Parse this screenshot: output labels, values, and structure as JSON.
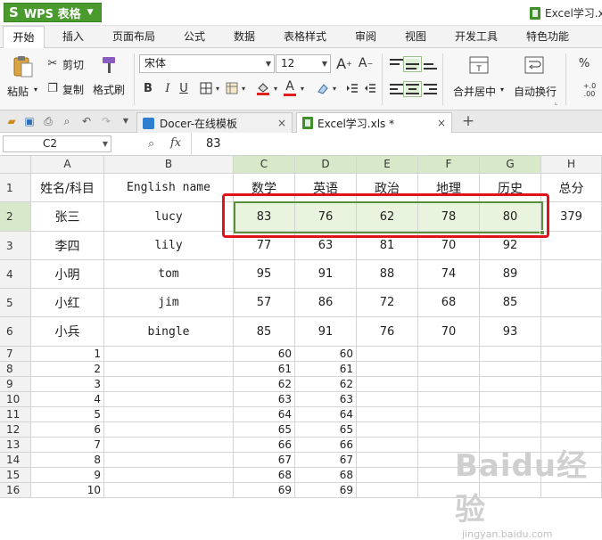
{
  "app": {
    "name": "WPS 表格",
    "logo_glyph": "S",
    "document_title": "Excel学习.x",
    "accent": "#4a9a2e"
  },
  "menu": [
    "开始",
    "插入",
    "页面布局",
    "公式",
    "数据",
    "表格样式",
    "审阅",
    "视图",
    "开发工具",
    "特色功能"
  ],
  "ribbon": {
    "paste": "粘贴",
    "cut": "剪切",
    "copy": "复制",
    "format_painter": "格式刷",
    "font_name": "宋体",
    "font_size": "12",
    "bold": "B",
    "italic": "I",
    "underline": "U",
    "font_color_letter": "A",
    "merge_center": "合并居中",
    "wrap_text": "自动换行",
    "percent": "%"
  },
  "tabs": [
    {
      "label": "Docer-在线模板",
      "close": "×"
    },
    {
      "label": "Excel学习.xls *",
      "close": "×"
    }
  ],
  "new_tab": "+",
  "formula_bar": {
    "cell_ref": "C2",
    "fx": "fx",
    "value": "83"
  },
  "columns": [
    "A",
    "B",
    "C",
    "D",
    "E",
    "F",
    "G",
    "H"
  ],
  "rows": [
    "1",
    "2",
    "3",
    "4",
    "5",
    "6",
    "7",
    "8",
    "9",
    "10",
    "11",
    "12",
    "13",
    "14",
    "15",
    "16"
  ],
  "header_row": [
    "姓名/科目",
    "English name",
    "数学",
    "英语",
    "政治",
    "地理",
    "历史",
    "总分"
  ],
  "students": [
    {
      "name": "张三",
      "en": "lucy",
      "scores": [
        "83",
        "76",
        "62",
        "78",
        "80"
      ],
      "total": "379"
    },
    {
      "name": "李四",
      "en": "lily",
      "scores": [
        "77",
        "63",
        "81",
        "70",
        "92"
      ],
      "total": ""
    },
    {
      "name": "小明",
      "en": "tom",
      "scores": [
        "95",
        "91",
        "88",
        "74",
        "89"
      ],
      "total": ""
    },
    {
      "name": "小红",
      "en": "jim",
      "scores": [
        "57",
        "86",
        "72",
        "68",
        "85"
      ],
      "total": ""
    },
    {
      "name": "小兵",
      "en": "bingle",
      "scores": [
        "85",
        "91",
        "76",
        "70",
        "93"
      ],
      "total": ""
    }
  ],
  "sequence_rows": [
    {
      "a": "1",
      "c": "60",
      "d": "60"
    },
    {
      "a": "2",
      "c": "61",
      "d": "61"
    },
    {
      "a": "3",
      "c": "62",
      "d": "62"
    },
    {
      "a": "4",
      "c": "63",
      "d": "63"
    },
    {
      "a": "5",
      "c": "64",
      "d": "64"
    },
    {
      "a": "6",
      "c": "65",
      "d": "65"
    },
    {
      "a": "7",
      "c": "66",
      "d": "66"
    },
    {
      "a": "8",
      "c": "67",
      "d": "67"
    },
    {
      "a": "9",
      "c": "68",
      "d": "68"
    },
    {
      "a": "10",
      "c": "69",
      "d": "69"
    }
  ],
  "watermark": {
    "brand": "Baidu经验",
    "url": "jingyan.baidu.com"
  },
  "colors": {
    "selection": "#5a8f3a",
    "highlight_box": "#e0121b",
    "selected_header": "#d7e9c8"
  }
}
